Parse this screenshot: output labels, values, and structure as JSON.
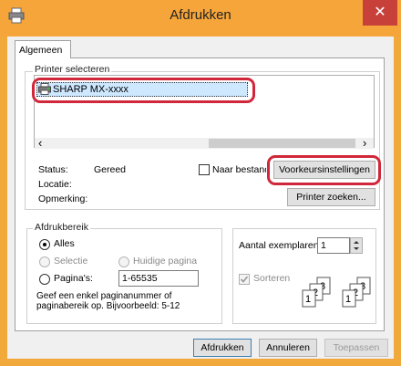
{
  "window": {
    "title": "Afdrukken",
    "close_glyph": "✕"
  },
  "tabs": [
    {
      "label": "Algemeen"
    }
  ],
  "printer_section": {
    "label": "Printer selecteren",
    "printer_name": "SHARP MX-xxxx",
    "scroll_left": "‹",
    "scroll_right": "›"
  },
  "status": {
    "status_label": "Status:",
    "status_value": "Gereed",
    "location_label": "Locatie:",
    "comment_label": "Opmerking:",
    "print_to_file_label": "Naar bestand",
    "preferences_button": "Voorkeursinstellingen",
    "find_printer_button": "Printer zoeken..."
  },
  "print_range": {
    "label": "Afdrukbereik",
    "all_label": "Alles",
    "selection_label": "Selectie",
    "current_page_label": "Huidige pagina",
    "pages_label": "Pagina's:",
    "pages_value": "1-65535",
    "hint": "Geef een enkel paginanummer of paginabereik op. Bijvoorbeeld: 5-12"
  },
  "copies": {
    "label": "Aantal exemplaren:",
    "value": "1",
    "collate_label": "Sorteren"
  },
  "footer": {
    "print_button": "Afdrukken",
    "cancel_button": "Annuleren",
    "apply_button": "Toepassen"
  },
  "colors": {
    "titlebar": "#f5a53a",
    "highlight": "#d0283a",
    "selection": "#cde8ff"
  }
}
